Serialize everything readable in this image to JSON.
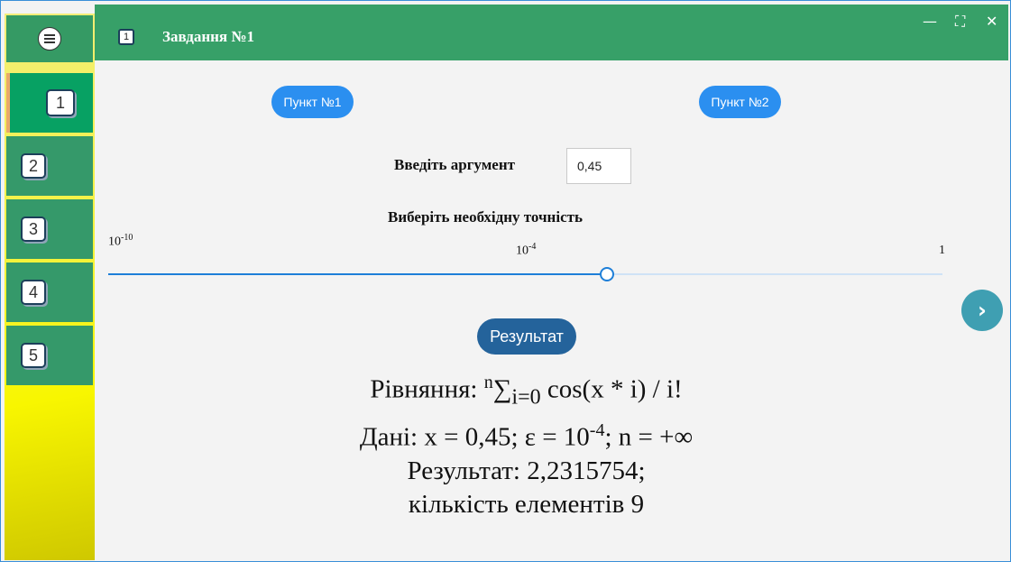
{
  "sidebar": {
    "menu_icon": "hamburger-icon",
    "items": [
      {
        "label": "1",
        "active": true
      },
      {
        "label": "2",
        "active": false
      },
      {
        "label": "3",
        "active": false
      },
      {
        "label": "4",
        "active": false
      },
      {
        "label": "5",
        "active": false
      }
    ]
  },
  "header": {
    "icon_label": "1",
    "title": "Завдання №1",
    "minimize_icon": "—",
    "maximize_icon": "⛶",
    "close_icon": "✕"
  },
  "main": {
    "tab1_label": "Пункт №1",
    "tab2_label": "Пункт №2",
    "argument_label": "Введіть аргумент",
    "argument_value": "0,45",
    "precision_label": "Виберіть необхідну точність",
    "slider": {
      "min_base": "10",
      "min_exp": "-10",
      "mid_base": "10",
      "mid_exp": "-4",
      "max_label": "1",
      "value_fraction": 0.6
    },
    "next_icon": "›",
    "result_button": "Результат",
    "result": {
      "eq_prefix": "Рівняння: ",
      "eq_sup": "n",
      "eq_sigma": "∑",
      "eq_sub": "i=0",
      "eq_suffix": " cos(x * i) / i!",
      "data_prefix": "Дані: x = 0,45; ε = 10",
      "data_exp": "-4",
      "data_suffix": "; n = +∞",
      "result_line": "Результат: 2,2315754;",
      "count_line": "кількість елементів 9"
    }
  },
  "colors": {
    "header_green": "#37a068",
    "active_item": "#07a163",
    "pill_blue": "#2b8ff0",
    "result_button": "#24639b",
    "next_button": "#3f9fb2"
  }
}
